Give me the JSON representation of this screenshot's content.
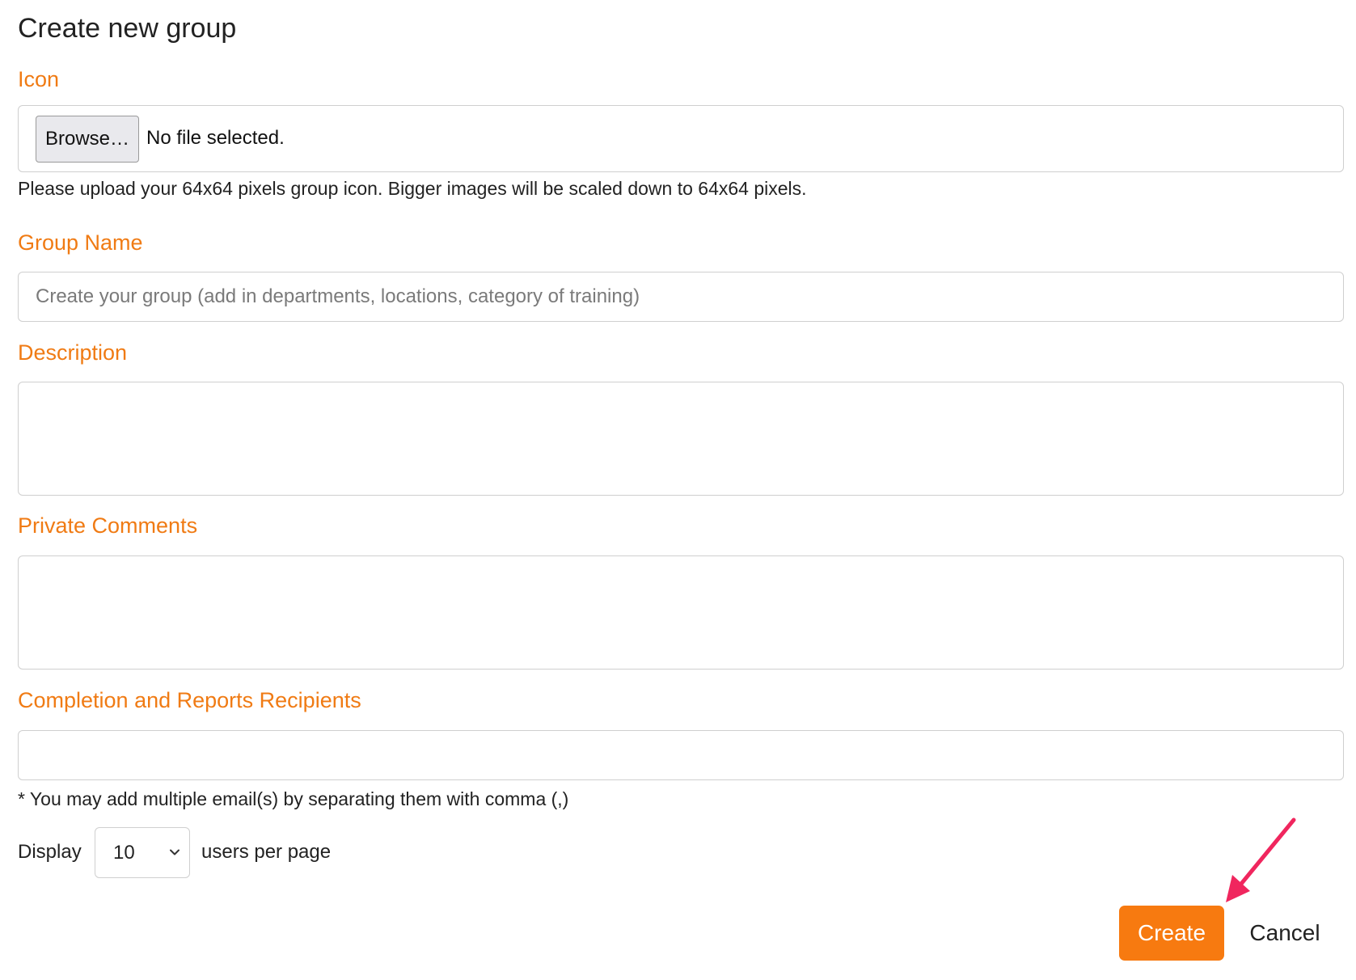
{
  "page": {
    "title": "Create new group"
  },
  "icon_field": {
    "label": "Icon",
    "browse_label": "Browse…",
    "file_status": "No file selected.",
    "help": "Please upload your 64x64 pixels group icon. Bigger images will be scaled down to 64x64 pixels."
  },
  "group_name": {
    "label": "Group Name",
    "placeholder": "Create your group (add in departments, locations, category of training)",
    "value": ""
  },
  "description": {
    "label": "Description",
    "value": ""
  },
  "private_comments": {
    "label": "Private Comments",
    "value": ""
  },
  "recipients": {
    "label": "Completion and Reports Recipients",
    "value": "",
    "help": "* You may add multiple email(s) by separating them with comma (,)"
  },
  "pagination": {
    "display_label": "Display",
    "selected_value": "10",
    "suffix_label": "users per page"
  },
  "actions": {
    "create_label": "Create",
    "cancel_label": "Cancel"
  },
  "colors": {
    "label_accent": "#f07b14",
    "primary_button": "#f77a10",
    "annotation_arrow": "#f0265e"
  },
  "icons": {
    "select_chevron": "chevron-down-icon",
    "annotation": "annotation-arrow-icon"
  }
}
